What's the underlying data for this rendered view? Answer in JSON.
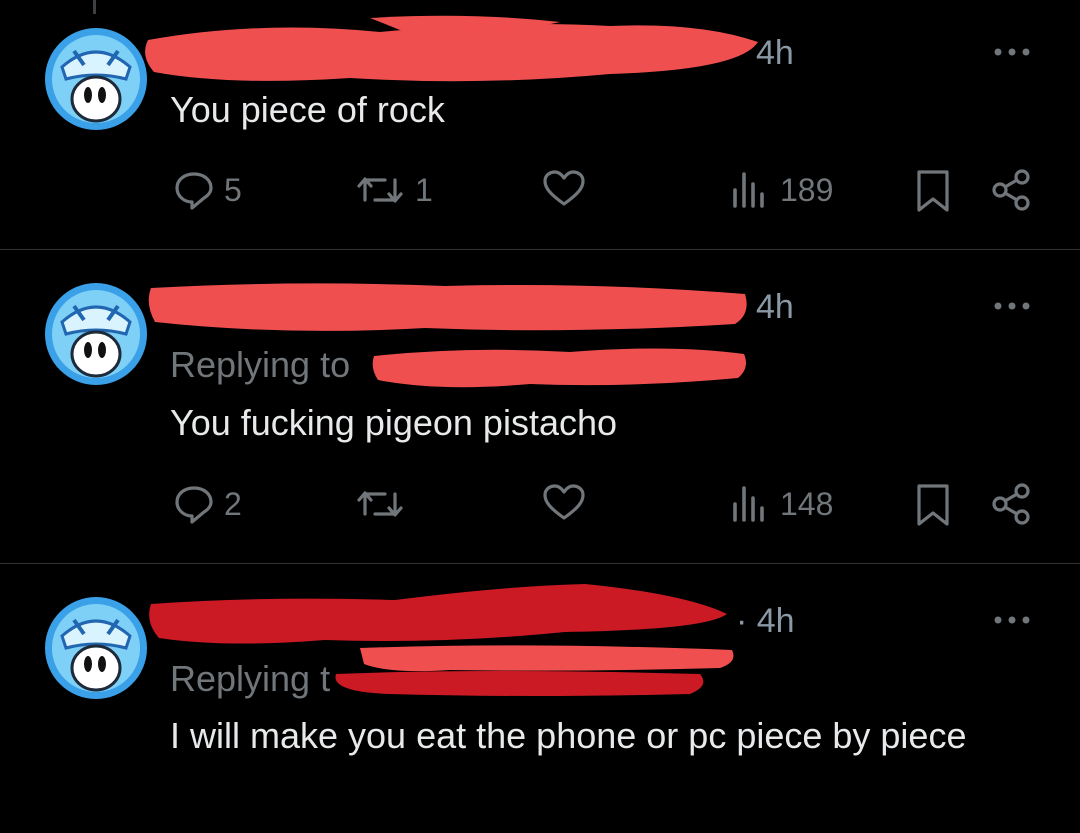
{
  "posts": [
    {
      "time": "4h",
      "replying_prefix": "",
      "text": "You piece of rock",
      "stats": {
        "replies": "5",
        "reposts": "1",
        "likes": "",
        "views": "189"
      }
    },
    {
      "time": "4h",
      "replying_prefix": "Replying to",
      "text": "You fucking pigeon pistacho",
      "stats": {
        "replies": "2",
        "reposts": "",
        "likes": "",
        "views": "148"
      }
    },
    {
      "time": "· 4h",
      "replying_prefix": "Replying t",
      "text": "I will make you eat the phone or pc piece by piece",
      "stats": null
    }
  ],
  "colors": {
    "background": "#000000",
    "text": "#e7e9ea",
    "muted": "#71767b",
    "redaction_light": "#f04f4f",
    "redaction_dark": "#cc1a24"
  },
  "icons": [
    "avatar",
    "more-icon",
    "reply-icon",
    "repost-icon",
    "like-icon",
    "views-icon",
    "bookmark-icon",
    "share-icon"
  ]
}
